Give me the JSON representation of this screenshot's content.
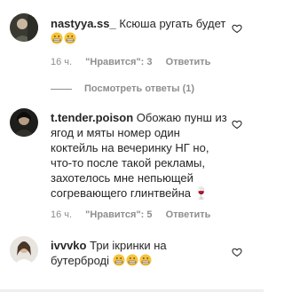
{
  "comments": [
    {
      "username": "nastyya.ss_",
      "text": "Ксюша ругать будет",
      "time": "16 ч.",
      "likes": "\"Нравится\": 3",
      "reply": "Ответить",
      "emojis": [
        "grimacing-face",
        "grimacing-face"
      ]
    },
    {
      "username": "t.tender.poison",
      "text": "Обожаю пунш из ягод и мяты номер один коктейль на вечеринку НГ но, что-то после такой рекламы, захотелось мне непьющей согревающего глинтвейна 🍷",
      "time": "16 ч.",
      "likes": "\"Нравится\": 5",
      "reply": "Ответить"
    },
    {
      "username": "ivvvko",
      "text": "Три ікринки на бутерброді",
      "emojis": [
        "grimacing-face",
        "grimacing-face",
        "grimacing-face"
      ]
    }
  ],
  "replies_toggle": "Посмотреть ответы (1)"
}
